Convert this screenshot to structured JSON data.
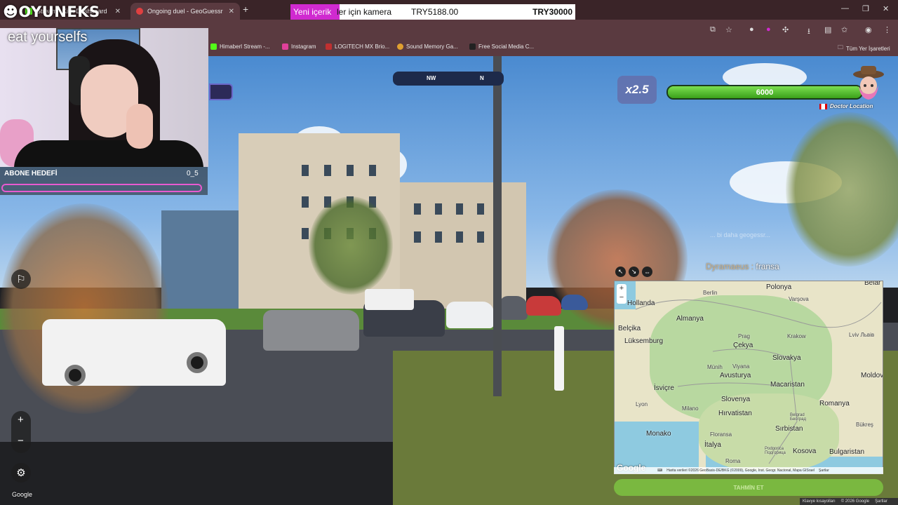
{
  "browser": {
    "tabs": [
      {
        "title": "Stream - Kick Dashboard",
        "color": "#53fc18"
      },
      {
        "title": "Ongoing duel - GeoGuessr",
        "color": "#e04040"
      }
    ],
    "new_tab": "+",
    "bookmarks": [
      {
        "label": "Himaberl Stream -...",
        "color": "#53fc18"
      },
      {
        "label": "Instagram",
        "color": "#e0409a"
      },
      {
        "label": "LOGITECH MX Brio...",
        "color": "#c03030"
      },
      {
        "label": "Sound Memory Ga...",
        "color": "#e0a030"
      },
      {
        "label": "Free Social Media C...",
        "color": "#222222"
      }
    ],
    "all_bookmarks": "Tüm Yer İşaretleri"
  },
  "stream": {
    "logo": "OYUNEKS",
    "caption": "eat yourselfs",
    "sub_goal_label": "ABONE HEDEFİ",
    "sub_goal_count": "0_5",
    "banner_highlight": "Yeni içerik",
    "banner_rest": "ler için kamera",
    "banner_amount": "TRY5188.00",
    "banner_goal": "TRY30000",
    "chat_user": "Dyramaeus :",
    "chat_message": "fransa",
    "ghost_text": "... bi daha geogessr..."
  },
  "game": {
    "compass": {
      "left": "NW",
      "right": "N"
    },
    "multiplier": "x2.5",
    "health": "6000",
    "health_fraction": 1.0,
    "player_name": "Doctor Location",
    "guess_button": "TAHMİN ET",
    "google": "Google"
  },
  "map": {
    "countries": [
      {
        "name": "Polonya"
      },
      {
        "name": "Hollanda"
      },
      {
        "name": "Almanya"
      },
      {
        "name": "Belçika"
      },
      {
        "name": "Lüksemburg"
      },
      {
        "name": "Çekya"
      },
      {
        "name": "Slovakya"
      },
      {
        "name": "Avusturya"
      },
      {
        "name": "Macaristan"
      },
      {
        "name": "İsviçre"
      },
      {
        "name": "Slovenya"
      },
      {
        "name": "Romanya"
      },
      {
        "name": "Hırvatistan"
      },
      {
        "name": "Sırbistan"
      },
      {
        "name": "Monako"
      },
      {
        "name": "İtalya"
      },
      {
        "name": "Kosova"
      },
      {
        "name": "Bulgaristan"
      },
      {
        "name": "Moldova"
      },
      {
        "name": "Belar"
      }
    ],
    "cities": [
      "Berlin",
      "Varşova",
      "Prag",
      "Krakow",
      "Lviv Львів",
      "Münih",
      "Viyana",
      "Lyon",
      "Milano",
      "Floransa",
      "Roma",
      "Belgrad Београд",
      "Bükreş",
      "Podgorica Подгорица"
    ],
    "google": "Google",
    "attribution": [
      "Klavye kısayolları",
      "Harita verileri ©2026 GeoBasis-DE/BKG (©2009), Google, Inst. Geogr. Nacional, Mapa GISrael",
      "Şartlar"
    ]
  },
  "footer": [
    "Klavye kısayolları",
    "© 2026 Google",
    "Şartlar"
  ]
}
